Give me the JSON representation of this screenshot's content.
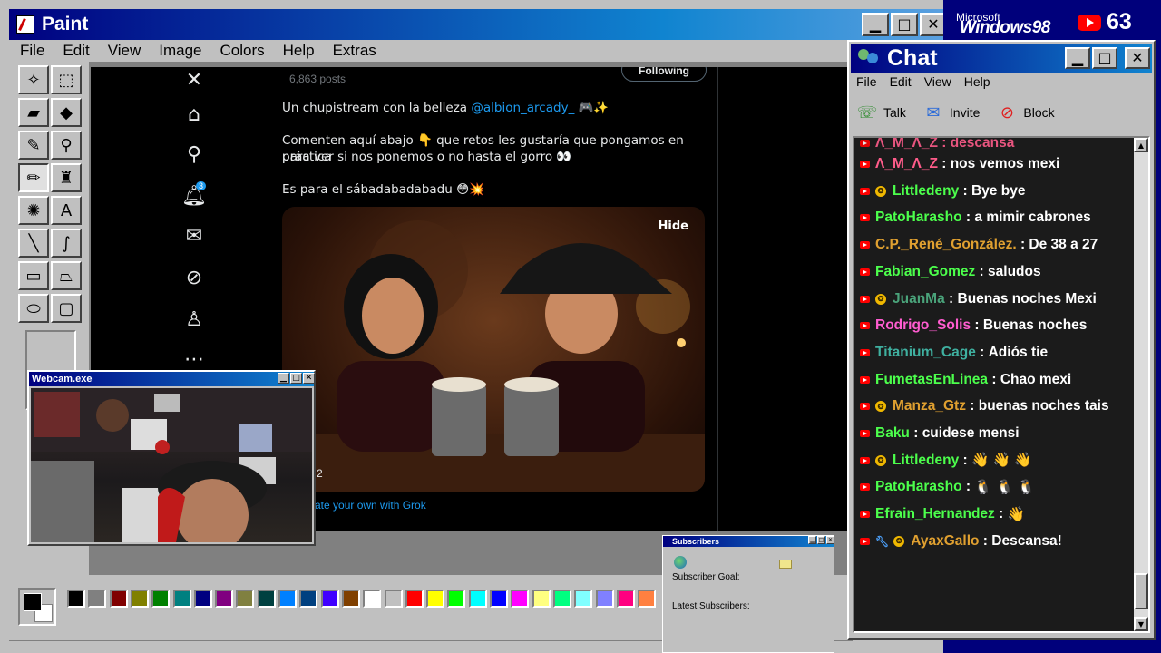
{
  "paint": {
    "title": "Paint",
    "menu": [
      "File",
      "Edit",
      "View",
      "Image",
      "Colors",
      "Help",
      "Extras"
    ],
    "tweet": {
      "posts": "6,863 posts",
      "follow_label": "Following",
      "line1_text": "Un chupistream con la belleza ",
      "line1_mention": "@albion_arcady_",
      "line1_emoji": "🎮✨",
      "line2a": "Comenten aquí abajo 👇 que retos les gustaría que pongamos en práctica",
      "line2b": "para ver si nos ponemos o no hasta el gorro 👀",
      "line3": "Es para el sábadabadabadu 😳💥",
      "hide_label": "Hide",
      "img_counter": "2",
      "grok_text": "ate your own with Grok",
      "notif_count": "3"
    },
    "palette_colors": [
      "#000000",
      "#808080",
      "#800000",
      "#808000",
      "#008000",
      "#008080",
      "#000080",
      "#800080",
      "#808040",
      "#004040",
      "#0080ff",
      "#004080",
      "#4000ff",
      "#804000",
      "#ffffff",
      "#c0c0c0",
      "#ff0000",
      "#ffff00",
      "#00ff00",
      "#00ffff",
      "#0000ff",
      "#ff00ff",
      "#ffff80",
      "#00ff80",
      "#80ffff",
      "#8080ff",
      "#ff0080",
      "#ff8040"
    ]
  },
  "webcam": {
    "title": "Webcam.exe"
  },
  "subscribers": {
    "title": "Subscribers",
    "goal_label": "Subscriber Goal:",
    "latest_label": "Latest Subscribers:"
  },
  "brand": {
    "microsoft": "Microsoft",
    "windows": "Windows98",
    "yt_count": "63"
  },
  "chat": {
    "title": "Chat",
    "menu": [
      "File",
      "Edit",
      "View",
      "Help"
    ],
    "toolbar": {
      "talk": "Talk",
      "invite": "Invite",
      "block": "Block"
    },
    "partial_top": "Λ_M_Λ_Z : descansa",
    "messages": [
      {
        "user": "Λ_M_Λ_Z",
        "text": "nos vemos mexi",
        "color": "#ff5c8a",
        "mod": false
      },
      {
        "user": "Littledeny",
        "text": "Bye bye",
        "color": "#4cff4c",
        "mod": true
      },
      {
        "user": "PatoHarasho",
        "text": "a mimir cabrones",
        "color": "#4cff4c",
        "mod": false
      },
      {
        "user": "C.P._René_González.",
        "text": "De 38 a 27",
        "color": "#e0a030",
        "mod": false
      },
      {
        "user": "Fabian_Gomez",
        "text": "saludos",
        "color": "#4cff4c",
        "mod": false
      },
      {
        "user": "JuanMa",
        "text": "Buenas noches Mexi",
        "color": "#4aa37a",
        "mod": true
      },
      {
        "user": "Rodrigo_Solis",
        "text": "Buenas noches",
        "color": "#ff5cd0",
        "mod": false
      },
      {
        "user": "Titanium_Cage",
        "text": "Adiós tie",
        "color": "#3fb0a0",
        "mod": false
      },
      {
        "user": "FumetasEnLinea",
        "text": "Chao mexi",
        "color": "#4cff4c",
        "mod": false
      },
      {
        "user": "Manza_Gtz",
        "text": "buenas noches tais",
        "color": "#e0a030",
        "mod": true
      },
      {
        "user": "Baku",
        "text": "cuidese mensi",
        "color": "#4cff4c",
        "mod": false
      },
      {
        "user": "Littledeny",
        "text": "👋 👋 👋",
        "color": "#4cff4c",
        "mod": true
      },
      {
        "user": "PatoHarasho",
        "text": "🐧 🐧 🐧",
        "color": "#4cff4c",
        "mod": false
      },
      {
        "user": "Efrain_Hernandez",
        "text": "👋",
        "color": "#4cff4c",
        "mod": false
      },
      {
        "user": "AyaxGallo",
        "text": "Descansa!",
        "color": "#e0a030",
        "mod": true,
        "wrench": true
      }
    ]
  }
}
